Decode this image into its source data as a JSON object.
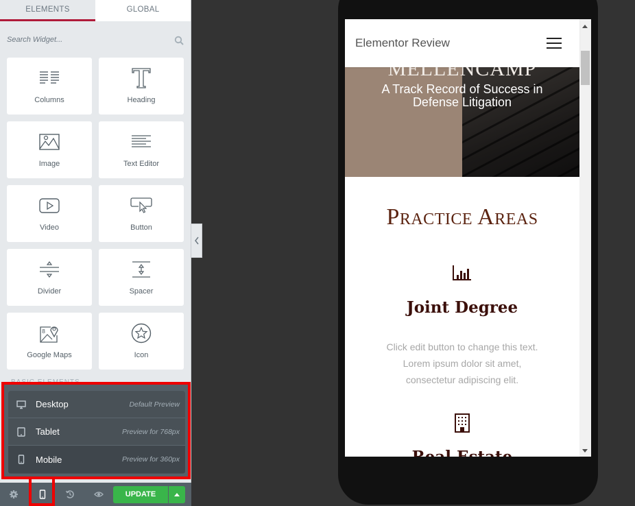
{
  "panel": {
    "tabs": [
      {
        "label": "ELEMENTS",
        "active": true
      },
      {
        "label": "GLOBAL",
        "active": false
      }
    ],
    "search": {
      "placeholder": "Search Widget...",
      "value": "",
      "icon": "search-icon"
    },
    "widgets": [
      {
        "label": "Columns",
        "icon": "columns-icon"
      },
      {
        "label": "Heading",
        "icon": "heading-icon"
      },
      {
        "label": "Image",
        "icon": "image-icon"
      },
      {
        "label": "Text Editor",
        "icon": "text-editor-icon"
      },
      {
        "label": "Video",
        "icon": "video-icon"
      },
      {
        "label": "Button",
        "icon": "button-icon"
      },
      {
        "label": "Divider",
        "icon": "divider-icon"
      },
      {
        "label": "Spacer",
        "icon": "spacer-icon"
      },
      {
        "label": "Google Maps",
        "icon": "google-maps-icon"
      },
      {
        "label": "Icon",
        "icon": "star-icon"
      }
    ],
    "responsive_menu": [
      {
        "label": "Desktop",
        "desc": "Default Preview",
        "icon": "desktop-icon"
      },
      {
        "label": "Tablet",
        "desc": "Preview for 768px",
        "icon": "tablet-icon"
      },
      {
        "label": "Mobile",
        "desc": "Preview for 360px",
        "icon": "mobile-icon"
      }
    ],
    "footer": {
      "settings_icon": "gear-icon",
      "responsive_icon": "mobile-icon",
      "history_icon": "history-icon",
      "preview_icon": "eye-icon",
      "update_label": "UPDATE",
      "update_color": "#39b54a"
    },
    "highlight_color": "#ee0000",
    "accent_color": "#b01b3a"
  },
  "preview": {
    "site_title": "Elementor Review",
    "hero_name": "MELLENCAMP",
    "hero_subtitle": "A Track Record of Success in Defense Litigation",
    "section_title": "Practice Areas",
    "practice_areas": [
      {
        "icon": "bar-chart-icon",
        "title": "Joint Degree",
        "text": "Click edit button to change this text. Lorem ipsum dolor sit amet, consectetur adipiscing elit."
      },
      {
        "icon": "building-icon",
        "title": "Real Estate"
      }
    ],
    "title_color": "#5b2310",
    "heading_color": "#3b0f0a"
  }
}
